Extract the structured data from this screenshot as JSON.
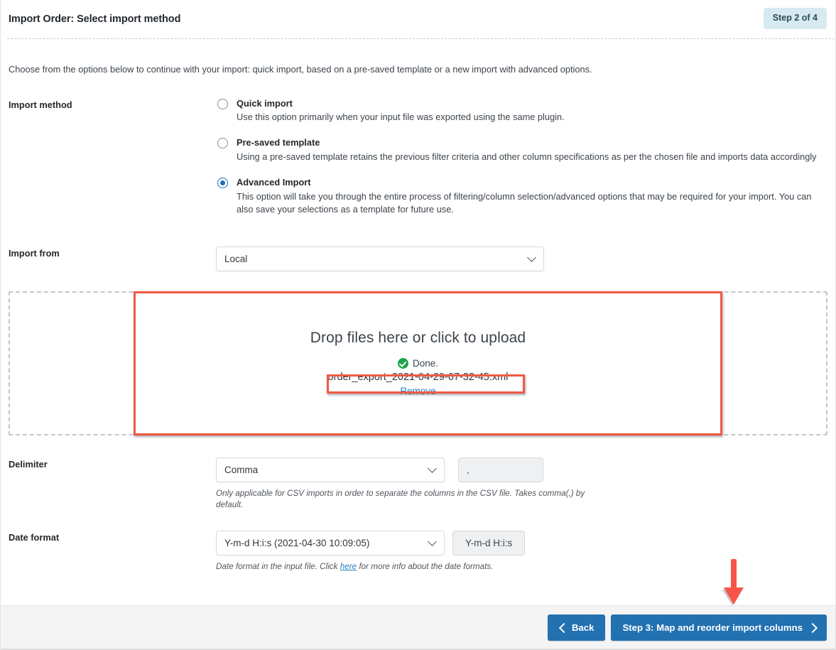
{
  "header": {
    "title": "Import Order: Select import method",
    "step_badge": "Step 2 of 4"
  },
  "intro": "Choose from the options below to continue with your import: quick import, based on a pre-saved template or a new import with advanced options.",
  "import_method": {
    "label": "Import method",
    "options": [
      {
        "title": "Quick import",
        "desc": "Use this option primarily when your input file was exported using the same plugin.",
        "selected": false
      },
      {
        "title": "Pre-saved template",
        "desc": "Using a pre-saved template retains the previous filter criteria and other column specifications as per the chosen file and imports data accordingly",
        "selected": false
      },
      {
        "title": "Advanced Import",
        "desc": "This option will take you through the entire process of filtering/column selection/advanced options that may be required for your import. You can also save your selections as a template for future use.",
        "selected": true
      }
    ]
  },
  "import_from": {
    "label": "Import from",
    "value": "Local"
  },
  "dropzone": {
    "title": "Drop files here or click to upload",
    "status": "Done.",
    "file_name": "order_export_2021-04-29-07-32-45.xml",
    "remove_label": "Remove"
  },
  "delimiter": {
    "label": "Delimiter",
    "value": "Comma",
    "char": ",",
    "hint": "Only applicable for CSV imports in order to separate the columns in the CSV file. Takes comma(,) by default."
  },
  "date_format": {
    "label": "Date format",
    "value": "Y-m-d H:i:s (2021-04-30 10:09:05)",
    "badge": "Y-m-d H:i:s",
    "hint_before": "Date format in the input file. Click ",
    "hint_link": "here",
    "hint_after": " for more info about the date formats."
  },
  "footer": {
    "back_label": "Back",
    "next_label": "Step 3: Map and reorder import columns"
  },
  "colors": {
    "accent": "#2271b1",
    "annotation": "#ef5a47",
    "badge_bg": "#d7eaf2",
    "success": "#1ea54c"
  }
}
